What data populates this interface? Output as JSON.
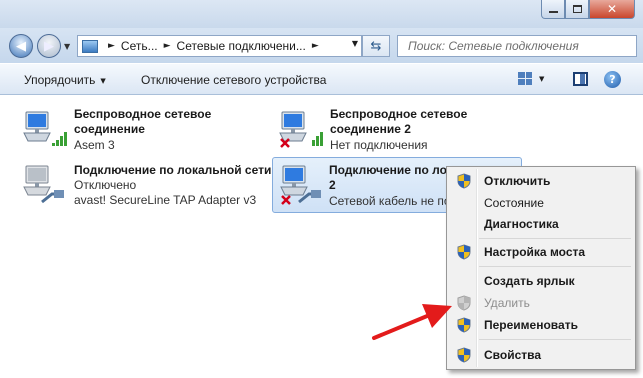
{
  "window": {
    "controls": {
      "minimize": "—",
      "maximize": "□",
      "close": "✕"
    }
  },
  "address": {
    "crumbs": [
      "Сеть...",
      "Сетевые подключени..."
    ],
    "search_placeholder": "Поиск: Сетевые подключения"
  },
  "toolbar": {
    "organize": "Упорядочить",
    "disable_device": "Отключение сетевого устройства"
  },
  "connections": [
    {
      "name_line1": "Беспроводное сетевое",
      "name_line2": "соединение",
      "status": "Asem  3",
      "signal": true,
      "disconnected": false,
      "selected": false
    },
    {
      "name_line1": "Беспроводное сетевое",
      "name_line2": "соединение 2",
      "status": "Нет подключения",
      "signal": true,
      "disconnected": true,
      "selected": false
    },
    {
      "name_line1": "Подключение по локальной сети",
      "status_line1": "Отключено",
      "status_line2": "avast! SecureLine TAP Adapter v3",
      "signal": false,
      "disconnected": false,
      "selected": false
    },
    {
      "name_line1": "Подключение по лока",
      "name_line2": "2",
      "status": "Сетевой кабель не по",
      "signal": false,
      "disconnected": true,
      "selected": true
    }
  ],
  "context_menu": {
    "items": [
      {
        "label": "Отключить",
        "shield": true,
        "bold": true,
        "disabled": false
      },
      {
        "label": "Состояние",
        "shield": false,
        "bold": false,
        "disabled": false
      },
      {
        "label": "Диагностика",
        "shield": false,
        "bold": true,
        "disabled": false
      },
      {
        "label": "Настройка моста",
        "shield": true,
        "bold": true,
        "disabled": false
      },
      {
        "label": "Создать ярлык",
        "shield": false,
        "bold": true,
        "disabled": false
      },
      {
        "label": "Удалить",
        "shield": true,
        "bold": false,
        "disabled": true
      },
      {
        "label": "Переименовать",
        "shield": true,
        "bold": true,
        "disabled": false
      },
      {
        "label": "Свойства",
        "shield": true,
        "bold": true,
        "disabled": false
      }
    ]
  },
  "icons": {
    "back": "back-arrow-icon",
    "forward": "forward-arrow-icon",
    "refresh": "refresh-icon",
    "search": "search-icon",
    "views": "change-view-icon",
    "preview": "preview-pane-icon",
    "help": "help-icon",
    "uac": "uac-shield-icon"
  },
  "colors": {
    "accent": "#3e74b7",
    "selection": "#cfe1f6",
    "error": "#d4001a",
    "arrow": "#e31b1b"
  }
}
